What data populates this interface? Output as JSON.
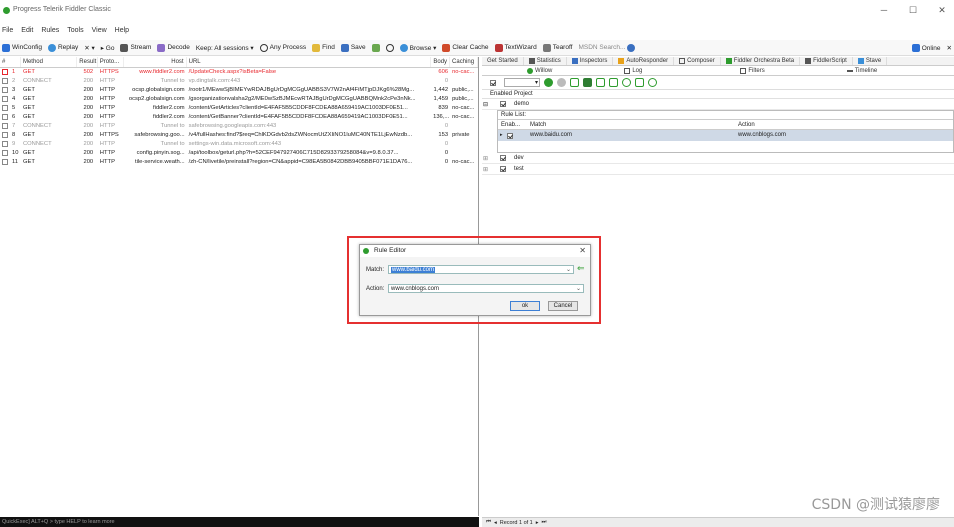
{
  "window": {
    "title": "Progress Telerik Fiddler Classic",
    "minimize": "─",
    "maximize": "☐",
    "close": "✕"
  },
  "menu": [
    "File",
    "Edit",
    "Rules",
    "Tools",
    "View",
    "Help"
  ],
  "toolbar": {
    "winconfig": "WinConfig",
    "replay": "Replay",
    "remove": "✕ ▾",
    "go": "▸ Go",
    "stream": "Stream",
    "decode": "Decode",
    "keep": "Keep: All sessions ▾",
    "any_process": "Any Process",
    "find": "Find",
    "save": "Save",
    "browse": "Browse ▾",
    "clear_cache": "Clear Cache",
    "textwizard": "TextWizard",
    "tearoff": "Tearoff",
    "msdn_search": "MSDN Search...",
    "online": "Online",
    "online_close": "✕"
  },
  "sessions": {
    "headers": [
      "#",
      "Method",
      "Result",
      "Proto...",
      "Host",
      "URL",
      "Body",
      "Caching"
    ],
    "rows": [
      {
        "id": "1",
        "method": "GET",
        "result": "502",
        "proto": "HTTPS",
        "host": "www.fiddler2.com",
        "url": "/UpdateCheck.aspx?isBeta=False",
        "body": "606",
        "caching": "no-cac...",
        "style": "red"
      },
      {
        "id": "2",
        "method": "CONNECT",
        "result": "200",
        "proto": "HTTP",
        "host": "Tunnel to",
        "url": "vp.dingtalk.com:443",
        "body": "0",
        "caching": "",
        "style": "gray"
      },
      {
        "id": "3",
        "method": "GET",
        "result": "200",
        "proto": "HTTP",
        "host": "ocsp.globalsign.com",
        "url": "/rootr1/MEwwSjBIMEYwRDAJBgUrDgMCGgUABBS3V7W2nAf4FiMTjpDJKg6%28Mg...",
        "body": "1,442",
        "caching": "public,...",
        "style": ""
      },
      {
        "id": "4",
        "method": "GET",
        "result": "200",
        "proto": "HTTP",
        "host": "ocsp2.globalsign.com",
        "url": "/gsorganizationvalsha2g2/ME0wSzBJMEcwRTAJBgUrDgMCGgUABBQMnk2cPe3nNk...",
        "body": "1,459",
        "caching": "public,...",
        "style": ""
      },
      {
        "id": "5",
        "method": "GET",
        "result": "200",
        "proto": "HTTP",
        "host": "fiddler2.com",
        "url": "/content/GetArticles?clientId=E4FAF5B5CDDF8FCDEA88A659419AC1003DF0E51...",
        "body": "839",
        "caching": "no-cac...",
        "style": ""
      },
      {
        "id": "6",
        "method": "GET",
        "result": "200",
        "proto": "HTTP",
        "host": "fiddler2.com",
        "url": "/content/GetBanner?clientId=E4FAF5B5CDDF8FCDEA88A659419AC1003DF0E51...",
        "body": "136,...",
        "caching": "no-cac...",
        "style": ""
      },
      {
        "id": "7",
        "method": "CONNECT",
        "result": "200",
        "proto": "HTTP",
        "host": "Tunnel to",
        "url": "safebrowsing.googleapis.com:443",
        "body": "0",
        "caching": "",
        "style": "gray"
      },
      {
        "id": "8",
        "method": "GET",
        "result": "200",
        "proto": "HTTPS",
        "host": "safebrowsing.goo...",
        "url": "/v4/fullHashes:find?$req=ChlKDGdvb2dsZWNocmUtZXIiNO1luMC40NTE1LjEwNzdb...",
        "body": "153",
        "caching": "private",
        "style": ""
      },
      {
        "id": "9",
        "method": "CONNECT",
        "result": "200",
        "proto": "HTTP",
        "host": "Tunnel to",
        "url": "settings-win.data.microsoft.com:443",
        "body": "0",
        "caching": "",
        "style": "gray"
      },
      {
        "id": "10",
        "method": "GET",
        "result": "200",
        "proto": "HTTP",
        "host": "config.pinyin.sog...",
        "url": "/api/toolbox/geturl.php?h=52CEF947927406C715D8293379258084&v=9.8.0.37...",
        "body": "0",
        "caching": "",
        "style": ""
      },
      {
        "id": "11",
        "method": "GET",
        "result": "200",
        "proto": "HTTP",
        "host": "tile-service.weath...",
        "url": "/zh-CN/livetile/preinstall?region=CN&appid=C98EA5B0842DBB9405BBF071E1DA76...",
        "body": "0",
        "caching": "no-cac...",
        "style": ""
      }
    ]
  },
  "status": {
    "quickexec": "QuickExec] ALT+Q > type HELP to learn more"
  },
  "right": {
    "tabs_row1": [
      "Get Started",
      "Statistics",
      "Inspectors",
      "AutoResponder",
      "Composer",
      "Fiddler Orchestra Beta",
      "FiddlerScript",
      "Stave"
    ],
    "tabs_row2": [
      "Willow",
      "Log",
      "Filters",
      "Timeline"
    ],
    "willow_dropdown": "",
    "project_headers": {
      "enabled": "Enabled",
      "project": "Project"
    },
    "projects": [
      {
        "name": "demo",
        "expanded": "⊟"
      },
      {
        "name": "dev",
        "expanded": "⊞"
      },
      {
        "name": "test",
        "expanded": "⊞"
      }
    ],
    "rule_list": {
      "label": "Rule List:",
      "headers": {
        "enabled": "Enab...",
        "match": "Match",
        "action": "Action"
      },
      "rows": [
        {
          "match": "www.baidu.com",
          "action": "www.cnblogs.com"
        }
      ]
    },
    "pager": {
      "text": "Record 1 of 1",
      "first": "⏮",
      "prev": "◂",
      "next": "▸",
      "last": "⏭"
    }
  },
  "dialog": {
    "title": "Rule Editor",
    "close": "✕",
    "match_label": "Match:",
    "match_value": "www.baidu.com",
    "action_label": "Action:",
    "action_value": "www.cnblogs.com",
    "ok": "ok",
    "cancel": "Cancel",
    "dropdown_glyph": "⌄",
    "apply_glyph": "⇐"
  },
  "watermark": "CSDN @测试猿廖廖"
}
